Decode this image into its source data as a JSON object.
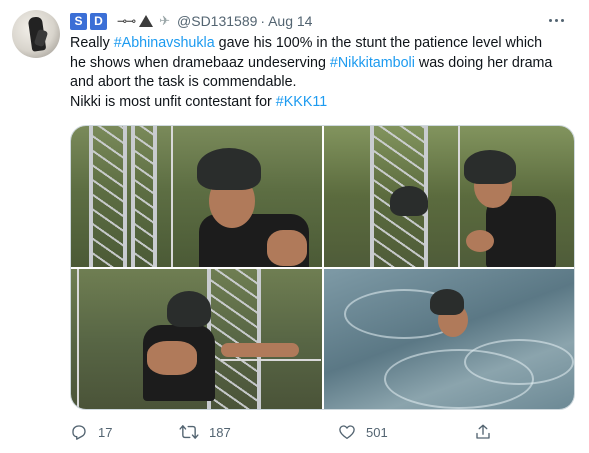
{
  "tweet": {
    "author": {
      "name_boxes": [
        "S",
        "D"
      ],
      "handle": "@SD131589",
      "separator": "·",
      "date": "Aug 14"
    },
    "text_lines": [
      {
        "parts": [
          {
            "t": "Really ",
            "tag": false
          },
          {
            "t": "#Abhinavshukla",
            "tag": true
          },
          {
            "t": " gave his 100% in the stunt the patience level which",
            "tag": false
          }
        ]
      },
      {
        "parts": [
          {
            "t": "he shows when dramebaaz undeserving ",
            "tag": false
          },
          {
            "t": "#Nikkitamboli",
            "tag": true
          },
          {
            "t": " was doing her drama",
            "tag": false
          }
        ]
      },
      {
        "parts": [
          {
            "t": "and abort the task is commendable.",
            "tag": false
          }
        ]
      },
      {
        "parts": [
          {
            "t": "Nikki is most unfit contestant for  ",
            "tag": false
          },
          {
            "t": "#KKK11",
            "tag": true
          }
        ]
      }
    ],
    "stats": {
      "replies": "17",
      "retweets": "187",
      "likes": "501"
    }
  },
  "icons": {
    "more": "more-dots-icon",
    "reply": "reply-icon",
    "retweet": "retweet-icon",
    "like": "heart-icon",
    "share": "share-icon"
  },
  "colors": {
    "link": "#1d9bf0",
    "muted": "#536471",
    "text": "#0f1419",
    "name_box": "#3b6fd6"
  }
}
